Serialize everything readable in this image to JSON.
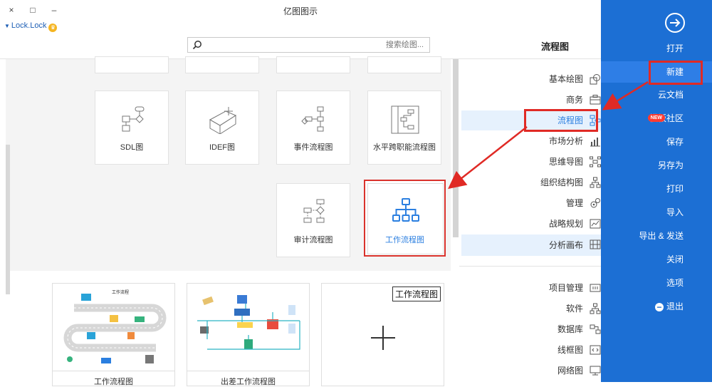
{
  "window": {
    "title": "亿图图示",
    "close_label": "×",
    "maximize_label": "□",
    "minimize_label": "–"
  },
  "user": {
    "name": "Lock.Lock"
  },
  "search": {
    "placeholder": "搜索绘图..."
  },
  "section_title": "流程图",
  "top_cards": [
    "",
    "",
    "",
    ""
  ],
  "templates_row1": [
    {
      "label": "水平跨职能流程图",
      "icon": "cross-functional-flowchart-icon"
    },
    {
      "label": "事件流程图",
      "icon": "event-flowchart-icon"
    },
    {
      "label": "IDEF图",
      "icon": "idef-diagram-icon"
    },
    {
      "label": "SDL图",
      "icon": "sdl-diagram-icon"
    }
  ],
  "templates_row2": [
    {
      "label": "工作流程图",
      "icon": "workflow-org-icon",
      "selected": true
    },
    {
      "label": "审计流程图",
      "icon": "audit-flowchart-icon"
    }
  ],
  "example_cards": [
    {
      "caption": "",
      "corner_title": "工作流程图",
      "type": "blank"
    },
    {
      "caption": "出差工作流程图",
      "type": "example"
    },
    {
      "caption": "工作流程图",
      "type": "example",
      "inner_title": "工作流程"
    }
  ],
  "categories": [
    {
      "label": "基本绘图",
      "icon": "basic-drawing-icon"
    },
    {
      "label": "商务",
      "icon": "briefcase-icon"
    },
    {
      "label": "流程图",
      "icon": "flowchart-icon",
      "highlighted": true
    },
    {
      "label": "市场分析",
      "icon": "bar-chart-icon"
    },
    {
      "label": "思维导图",
      "icon": "mindmap-icon"
    },
    {
      "label": "组织结构图",
      "icon": "org-chart-icon"
    },
    {
      "label": "管理",
      "icon": "gears-icon"
    },
    {
      "label": "战略规划",
      "icon": "strategy-icon"
    },
    {
      "label": "分析画布",
      "icon": "canvas-icon",
      "highlighted": true
    },
    {
      "label": "项目管理",
      "icon": "project-icon"
    },
    {
      "label": "软件",
      "icon": "software-icon"
    },
    {
      "label": "数据库",
      "icon": "database-icon"
    },
    {
      "label": "线框图",
      "icon": "wireframe-icon"
    },
    {
      "label": "网络图",
      "icon": "network-icon"
    }
  ],
  "sidebar": {
    "items": [
      {
        "label": "打开"
      },
      {
        "label": "新建",
        "active": true
      },
      {
        "label": "云文档"
      },
      {
        "label": "模板社区",
        "badge": "NEW"
      },
      {
        "label": "保存"
      },
      {
        "label": "另存为"
      },
      {
        "label": "打印"
      },
      {
        "label": "导入"
      },
      {
        "label": "导出 & 发送"
      },
      {
        "label": "关闭"
      },
      {
        "label": "选项"
      },
      {
        "label": "退出"
      }
    ]
  },
  "colors": {
    "sidebar": "#1c6fd4",
    "accent": "#2b7fe0",
    "annotation": "#e02a25"
  }
}
